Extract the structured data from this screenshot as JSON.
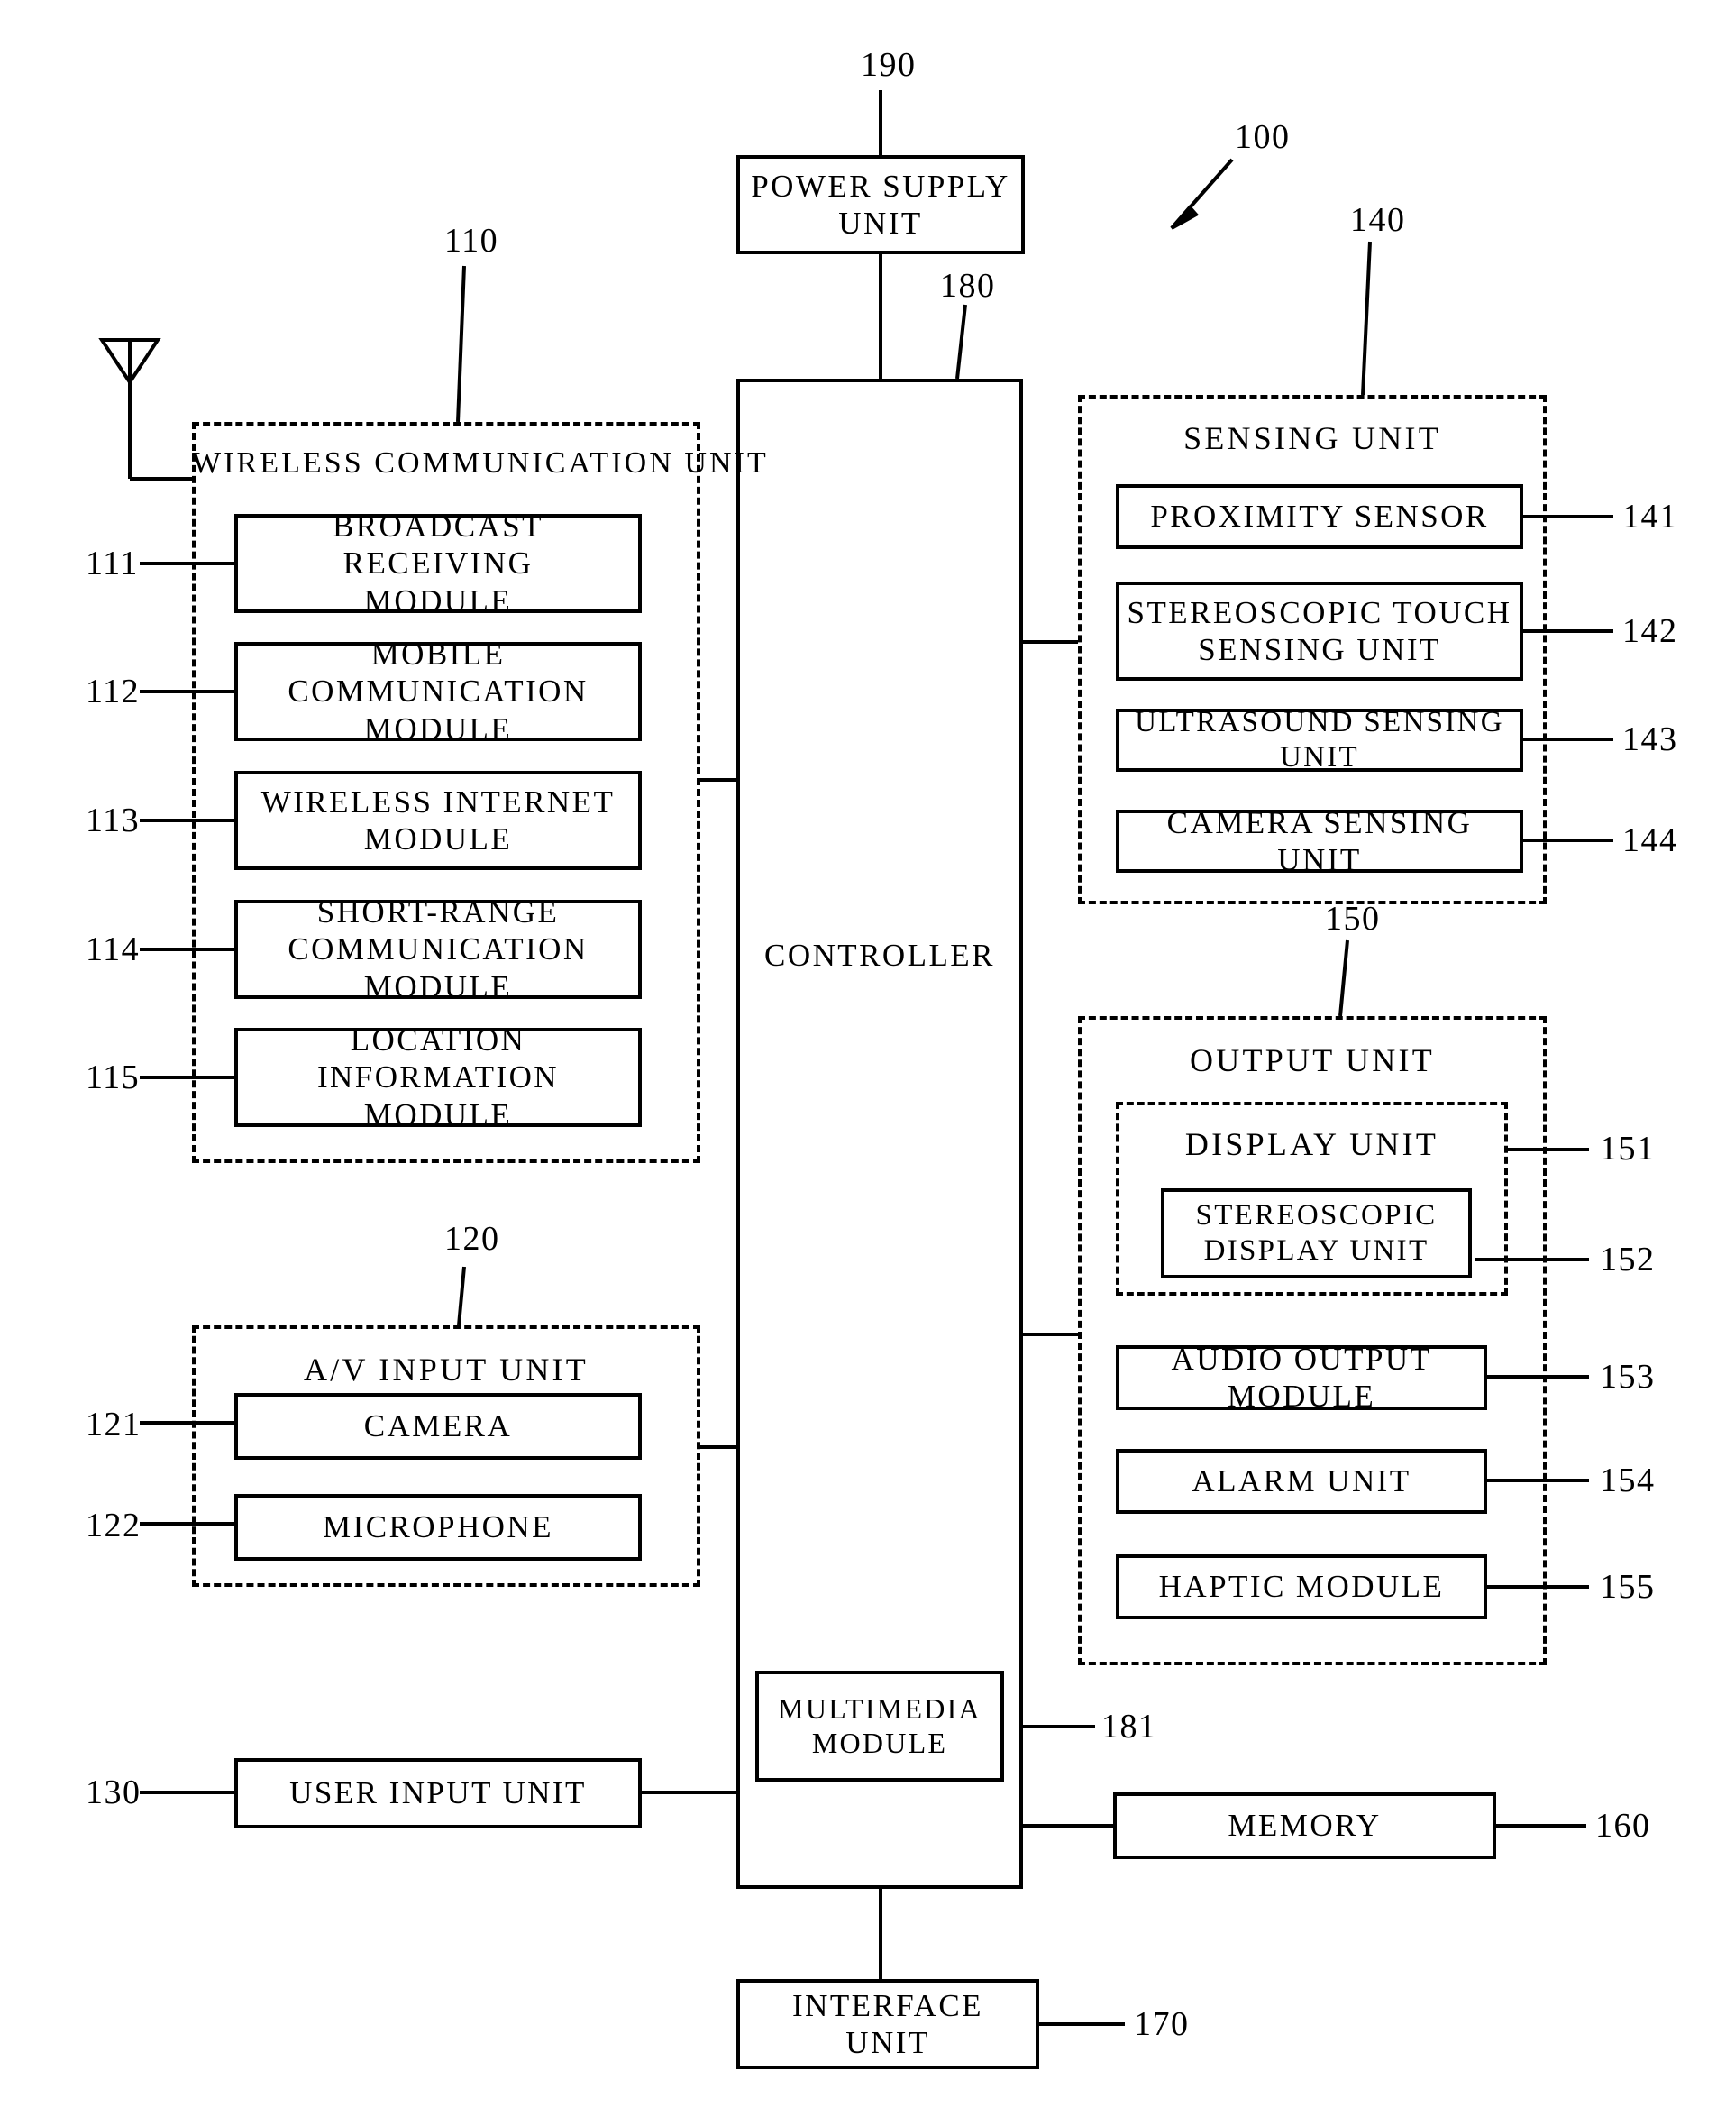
{
  "figure": {
    "device_ref": "100",
    "antenna": "antenna-symbol"
  },
  "power_supply": {
    "label": "POWER SUPPLY\nUNIT",
    "ref": "190"
  },
  "controller": {
    "label": "CONTROLLER",
    "ref": "180",
    "multimedia_module": {
      "label": "MULTIMEDIA\nMODULE",
      "ref": "181"
    }
  },
  "wireless_communication_unit": {
    "title": "WIRELESS COMMUNICATION UNIT",
    "ref": "110",
    "modules": [
      {
        "label": "BROADCAST RECEIVING\nMODULE",
        "ref": "111"
      },
      {
        "label": "MOBILE COMMUNICATION\nMODULE",
        "ref": "112"
      },
      {
        "label": "WIRELESS INTERNET\nMODULE",
        "ref": "113"
      },
      {
        "label": "SHORT-RANGE\nCOMMUNICATION MODULE",
        "ref": "114"
      },
      {
        "label": "LOCATION INFORMATION\nMODULE",
        "ref": "115"
      }
    ]
  },
  "av_input_unit": {
    "title": "A/V INPUT UNIT",
    "ref": "120",
    "modules": [
      {
        "label": "CAMERA",
        "ref": "121"
      },
      {
        "label": "MICROPHONE",
        "ref": "122"
      }
    ]
  },
  "user_input_unit": {
    "label": "USER INPUT UNIT",
    "ref": "130"
  },
  "sensing_unit": {
    "title": "SENSING UNIT",
    "ref": "140",
    "modules": [
      {
        "label": "PROXIMITY SENSOR",
        "ref": "141"
      },
      {
        "label": "STEREOSCOPIC TOUCH\nSENSING UNIT",
        "ref": "142"
      },
      {
        "label": "ULTRASOUND SENSING UNIT",
        "ref": "143"
      },
      {
        "label": "CAMERA SENSING UNIT",
        "ref": "144"
      }
    ]
  },
  "output_unit": {
    "title": "OUTPUT UNIT",
    "ref": "150",
    "display_unit": {
      "title": "DISPLAY UNIT",
      "ref": "151",
      "stereoscopic_display_unit": {
        "label": "STEREOSCOPIC\nDISPLAY UNIT",
        "ref": "152"
      }
    },
    "modules": [
      {
        "label": "AUDIO OUTPUT MODULE",
        "ref": "153"
      },
      {
        "label": "ALARM UNIT",
        "ref": "154"
      },
      {
        "label": "HAPTIC MODULE",
        "ref": "155"
      }
    ]
  },
  "memory": {
    "label": "MEMORY",
    "ref": "160"
  },
  "interface_unit": {
    "label": "INTERFACE UNIT",
    "ref": "170"
  }
}
